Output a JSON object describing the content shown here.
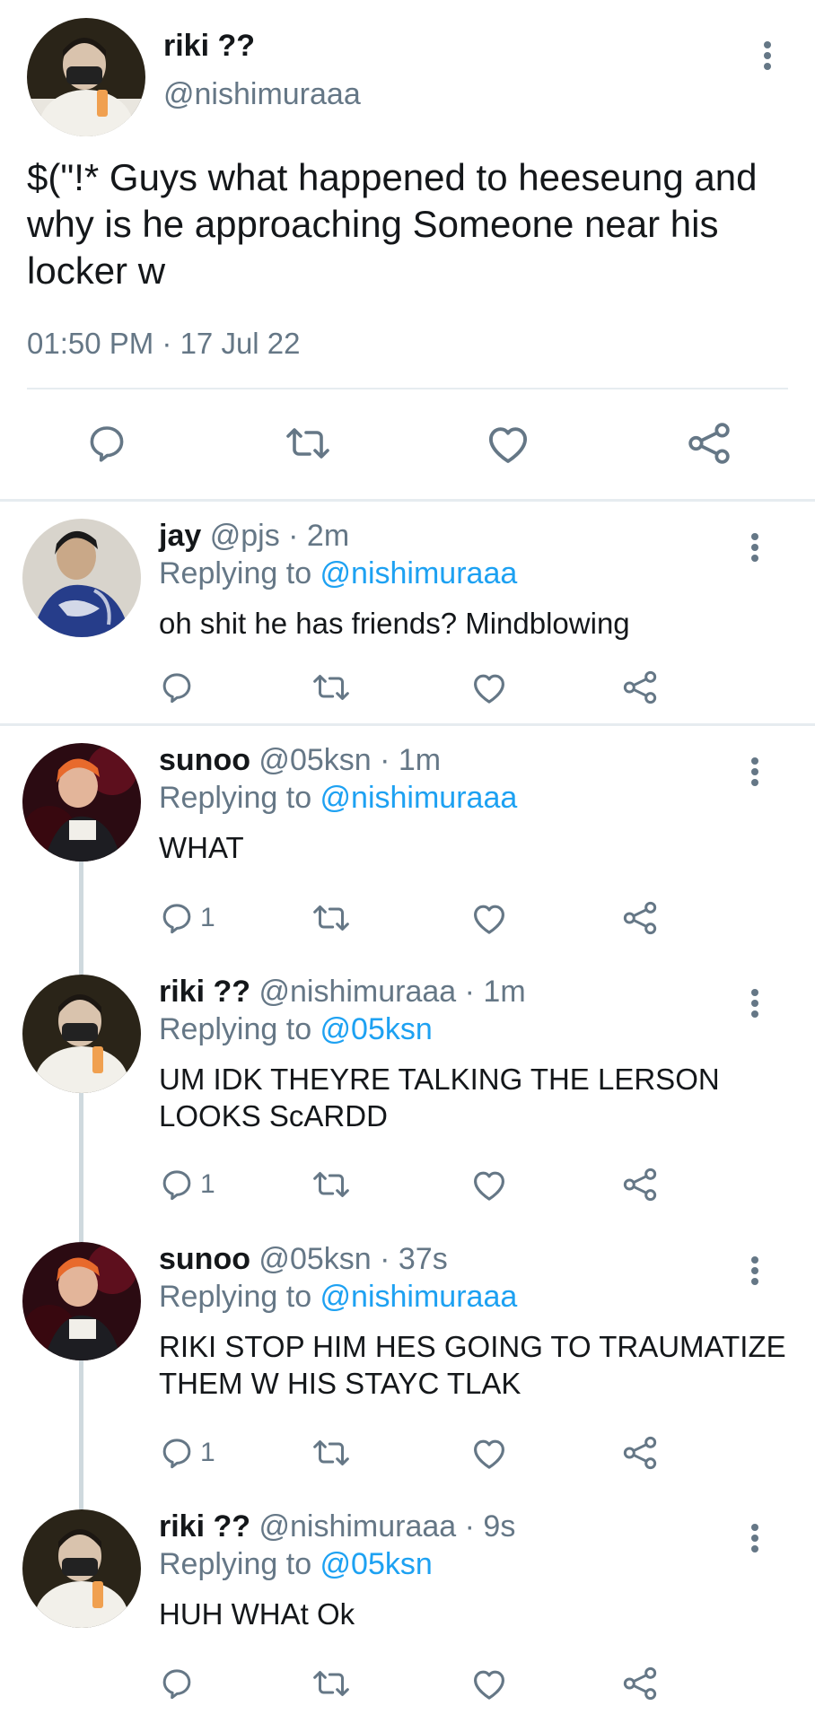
{
  "main_tweet": {
    "name": "riki ??",
    "handle": "@nishimuraaa",
    "text": "$(\"!* Guys what happened to heeseung and why is he approaching Someone near his locker w",
    "timestamp": "01:50 PM · 17 Jul 22"
  },
  "replies": [
    {
      "name": "jay",
      "meta": " @pjs · 2m",
      "replying_prefix": "Replying to ",
      "replying_to": "@nishimuraaa",
      "text": "oh shit he has friends? Mindblowing",
      "reply_count": ""
    },
    {
      "name": "sunoo",
      "meta": " @05ksn · 1m",
      "replying_prefix": "Replying to ",
      "replying_to": "@nishimuraaa",
      "text": "WHAT",
      "reply_count": "1"
    },
    {
      "name": "riki ??",
      "meta": " @nishimuraaa · 1m",
      "replying_prefix": "Replying to ",
      "replying_to": "@05ksn",
      "text": "UM IDK THEYRE TALKING THE LERSON LOOKS ScARDD",
      "reply_count": "1"
    },
    {
      "name": "sunoo",
      "meta": " @05ksn · 37s",
      "replying_prefix": "Replying to ",
      "replying_to": "@nishimuraaa",
      "text": "RIKI STOP HIM HES GOING TO TRAUMATIZE THEM W HIS STAYC TLAK",
      "reply_count": "1"
    },
    {
      "name": "riki ??",
      "meta": " @nishimuraaa · 9s",
      "replying_prefix": "Replying to ",
      "replying_to": "@05ksn",
      "text": "HUH WHAt Ok",
      "reply_count": ""
    }
  ],
  "icons": {
    "reply": "reply-icon",
    "retweet": "retweet-icon",
    "like": "heart-icon",
    "share": "share-icon",
    "more": "more-options-icon"
  },
  "colors": {
    "text": "#14171a",
    "secondary": "#657786",
    "link": "#1da1f2",
    "divider": "#e6ecf0"
  }
}
